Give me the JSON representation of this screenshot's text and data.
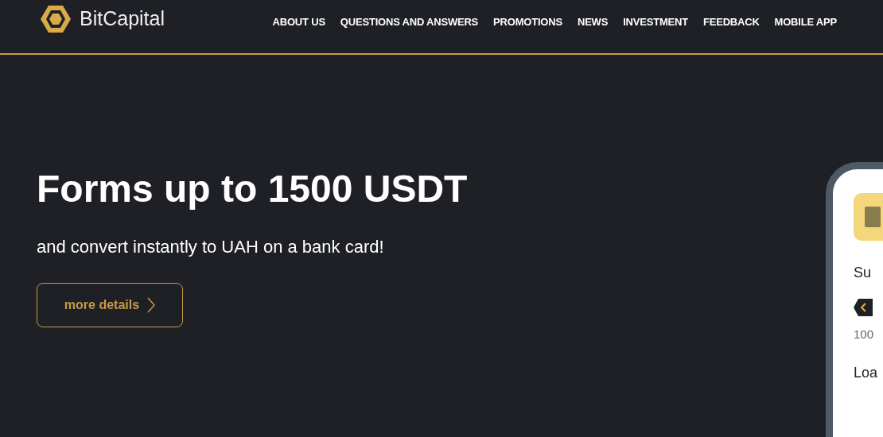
{
  "header": {
    "brand": "BitCapital",
    "nav": [
      {
        "label": "ABOUT US"
      },
      {
        "label": "QUESTIONS AND ANSWERS"
      },
      {
        "label": "PROMOTIONS"
      },
      {
        "label": "NEWS"
      },
      {
        "label": "INVESTMENT"
      },
      {
        "label": "FEEDBACK"
      },
      {
        "label": "MOBILE APP"
      }
    ]
  },
  "hero": {
    "title": "Forms up to 1500 USDT",
    "subtitle": "and convert instantly to UAH on a bank card!",
    "button": "more details"
  },
  "phone": {
    "sum_label": "Su",
    "amount": "100",
    "loan_label": "Loa"
  }
}
